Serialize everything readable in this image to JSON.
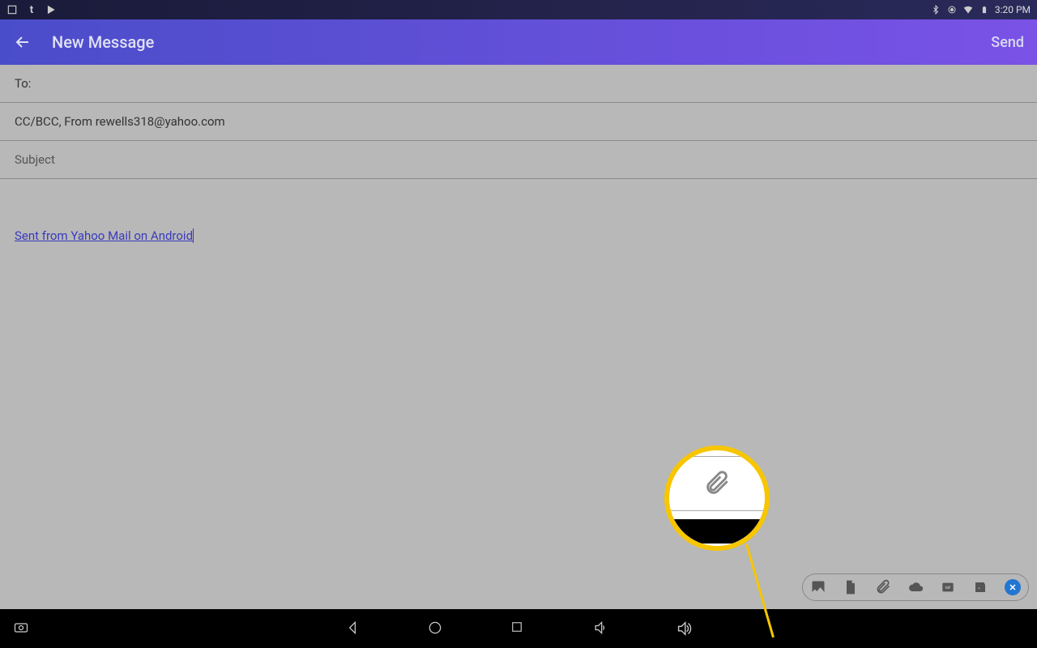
{
  "statusbar": {
    "time": "3:20 PM",
    "icons_left": [
      "screenshot",
      "tumblr",
      "play"
    ],
    "icons_right": [
      "bluetooth",
      "target",
      "wifi",
      "battery"
    ]
  },
  "appbar": {
    "title": "New Message",
    "send_label": "Send"
  },
  "compose": {
    "to_label": "To:",
    "ccbcc_label": "CC/BCC, From rewells318@yahoo.com",
    "subject_placeholder": "Subject",
    "signature": "Sent from Yahoo Mail on Android"
  },
  "attach_toolbar": {
    "icons": [
      "image",
      "document",
      "paperclip",
      "cloud",
      "gif",
      "sticker",
      "close"
    ]
  },
  "callout": {
    "highlighted_icon": "paperclip"
  }
}
